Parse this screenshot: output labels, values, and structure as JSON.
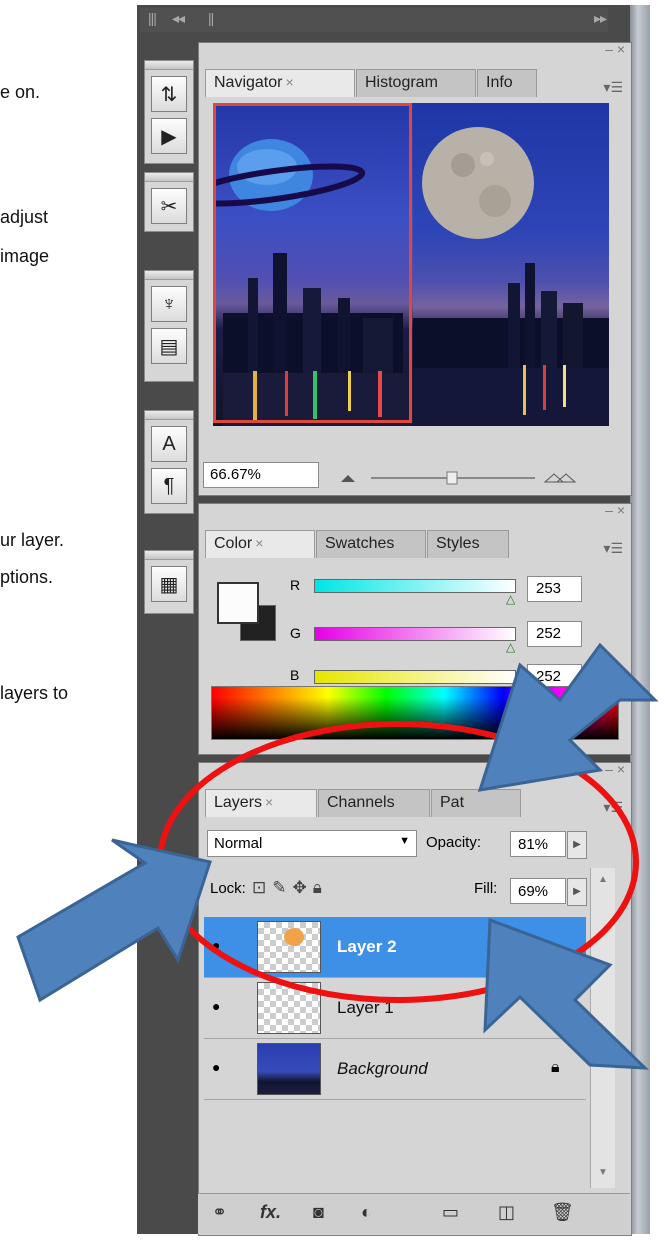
{
  "document_fragments": [
    "e on.",
    "adjust",
    "image",
    "ur layer.",
    "ptions.",
    "layers to"
  ],
  "collapse_glyph": "◂◂",
  "expand_glyph": "▸▸",
  "navigator": {
    "tabs": [
      {
        "label": "Navigator",
        "close": "×"
      },
      {
        "label": "Histogram"
      },
      {
        "label": "Info"
      }
    ],
    "zoom": "66.67%",
    "zoom_slider_level": 0.67,
    "accent": "#e0483e"
  },
  "color": {
    "tabs": [
      {
        "label": "Color",
        "close": "×"
      },
      {
        "label": "Swatches"
      },
      {
        "label": "Styles"
      }
    ],
    "channels": [
      {
        "label": "R",
        "value": "253",
        "gradient_from": "#00e6e6",
        "gradient_to": "#ffffff"
      },
      {
        "label": "G",
        "value": "252",
        "gradient_from": "#e600e6",
        "gradient_to": "#ffffff"
      },
      {
        "label": "B",
        "value": "252",
        "gradient_from": "#e6e600",
        "gradient_to": "#ffffff"
      }
    ]
  },
  "layers": {
    "tabs": [
      {
        "label": "Layers",
        "close": "×"
      },
      {
        "label": "Channels"
      },
      {
        "label": "Pat"
      }
    ],
    "blend_mode": "Normal",
    "opacity_label": "Opacity:",
    "opacity_value": "81%",
    "lock_label": "Lock:",
    "fill_label": "Fill:",
    "fill_value": "69%",
    "items": [
      {
        "name": "Layer 2",
        "selected": true
      },
      {
        "name": "Layer 1",
        "selected": false
      },
      {
        "name": "Background",
        "selected": false,
        "italic": true,
        "locked": true
      }
    ],
    "selection_color": "#3e8fe6"
  },
  "annotation": {
    "ellipse_color": "#ee1111",
    "arrow_color": "#4f81bd"
  }
}
